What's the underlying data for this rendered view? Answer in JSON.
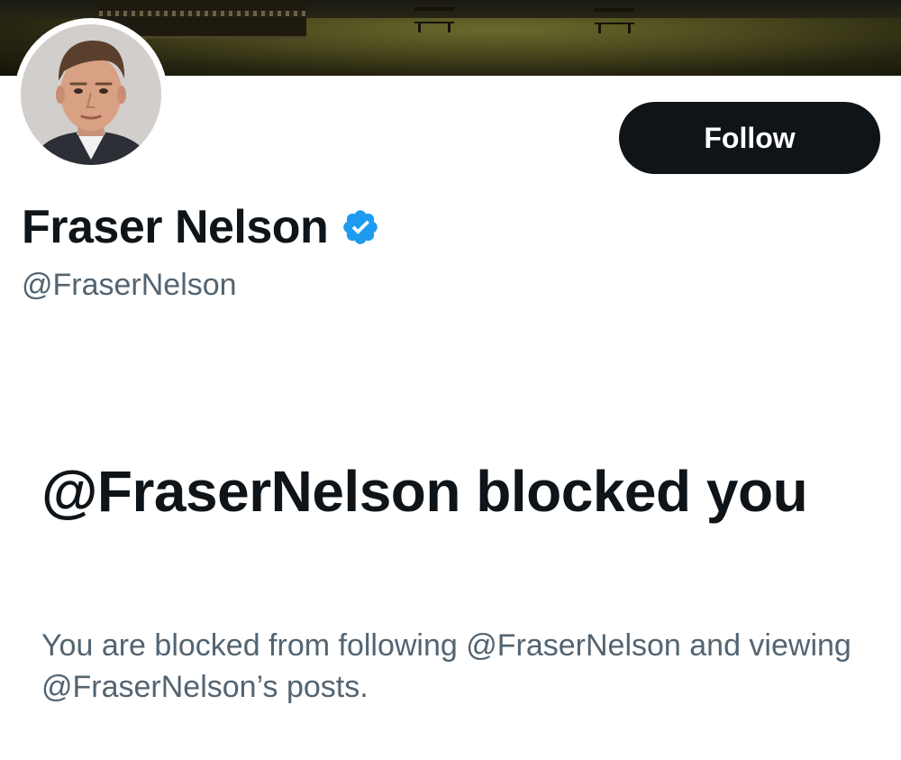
{
  "profile": {
    "display_name": "Fraser Nelson",
    "handle": "@FraserNelson",
    "verified": true,
    "verified_color": "#1d9bf0",
    "avatar_icon": "profile-photo"
  },
  "actions": {
    "follow_label": "Follow"
  },
  "blocked_notice": {
    "title": "@FraserNelson blocked you",
    "description": "You are blocked from following @FraserNelson and viewing @FraserNelson’s posts."
  },
  "colors": {
    "primary_text": "#0f1419",
    "secondary_text": "#536471",
    "button_bg": "#0f1419",
    "button_text": "#ffffff"
  }
}
